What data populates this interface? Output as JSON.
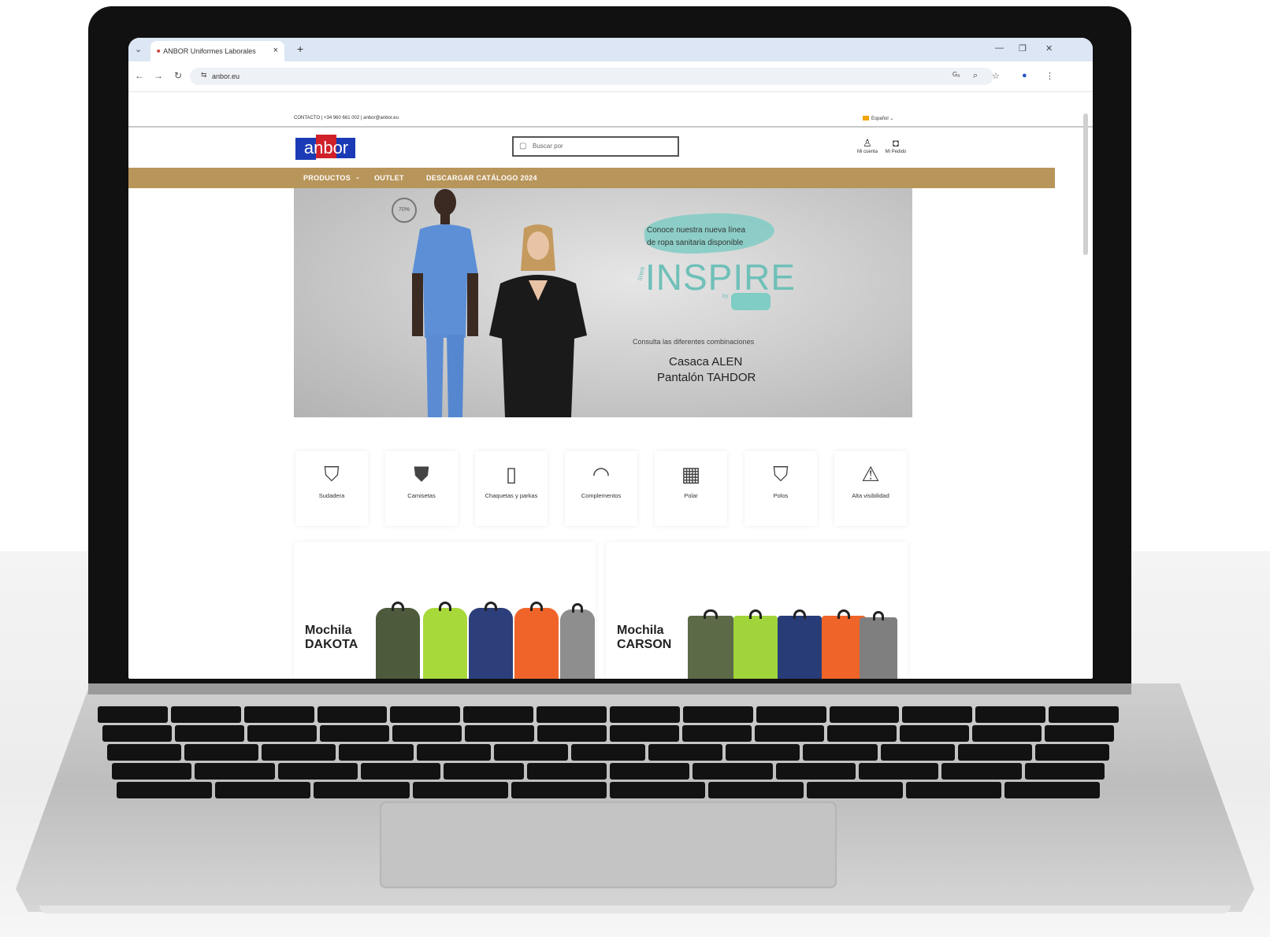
{
  "browser": {
    "tab_title": "ANBOR Uniformes Laborales",
    "url": "anbor.eu",
    "new_tab": "+",
    "close": "×",
    "translate_icon": "translate-icon"
  },
  "site": {
    "contact": "CONTACTO | +34 960 661 002 | anbor@anbor.eu",
    "language": "Español",
    "logo_text": "anbor",
    "search_placeholder": "Buscar por",
    "account_label": "Mi cuenta",
    "cart_label": "Mi Pedido",
    "menu": [
      "PRODUCTOS",
      "OUTLET",
      "DESCARGAR CATÁLOGO 2024"
    ]
  },
  "hero": {
    "badge": "70%",
    "intro_line1": "Conoce nuestra nueva línea",
    "intro_line2": "de ropa sanitaria disponible",
    "line_small": "línea",
    "brand": "INSPIRE",
    "by": "by",
    "subtitle": "Consulta las diferentes combinaciones",
    "product1": "Casaca ALEN",
    "product2": "Pantalón TAHDOR"
  },
  "categories": [
    {
      "label": "Sudadera",
      "icon": "hoodie-icon"
    },
    {
      "label": "Camisetas",
      "icon": "tshirt-icon"
    },
    {
      "label": "Chaquetas y parkas",
      "icon": "jacket-icon"
    },
    {
      "label": "Complementos",
      "icon": "cap-icon"
    },
    {
      "label": "Polar",
      "icon": "fleece-icon"
    },
    {
      "label": "Polos",
      "icon": "polo-icon"
    },
    {
      "label": "Alta visibilidad",
      "icon": "hi-vis-icon"
    }
  ],
  "promos": [
    {
      "title": "Mochila DAKOTA"
    },
    {
      "title": "Mochila CARSON"
    }
  ],
  "colors": {
    "menu_bar": "#b8955a",
    "teal": "#6fc0b8",
    "logo_blue": "#1a3bb5",
    "logo_red": "#d0202a"
  }
}
